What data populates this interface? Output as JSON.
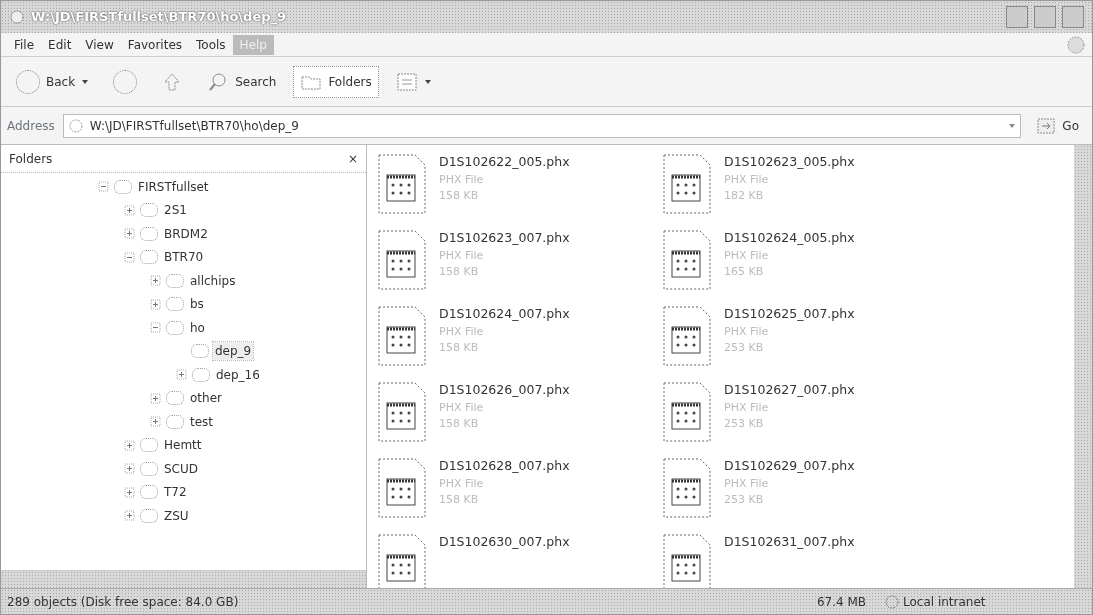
{
  "window": {
    "title": "W:\\JD\\FIRSTfullset\\BTR70\\ho\\dep_9"
  },
  "menu": [
    {
      "label": "File",
      "selected": false
    },
    {
      "label": "Edit",
      "selected": false
    },
    {
      "label": "View",
      "selected": false
    },
    {
      "label": "Favorites",
      "selected": false
    },
    {
      "label": "Tools",
      "selected": false
    },
    {
      "label": "Help",
      "selected": true
    }
  ],
  "toolbar": {
    "back": "Back",
    "search": "Search",
    "folders": {
      "label": "Folders",
      "selected": true
    }
  },
  "address": {
    "label": "Address",
    "value": "W:\\JD\\FIRSTfullset\\BTR70\\ho\\dep_9",
    "go": "Go"
  },
  "sidebar": {
    "title": "Folders",
    "close": "×",
    "items": [
      {
        "label": "FIRSTfullset",
        "expandable": true,
        "expanded": true,
        "selected": false,
        "children": [
          {
            "label": "2S1",
            "expandable": true,
            "expanded": false,
            "selected": false
          },
          {
            "label": "BRDM2",
            "expandable": true,
            "expanded": false,
            "selected": false
          },
          {
            "label": "BTR70",
            "expandable": true,
            "expanded": true,
            "selected": false,
            "children": [
              {
                "label": "allchips",
                "expandable": true,
                "expanded": false,
                "selected": false
              },
              {
                "label": "bs",
                "expandable": true,
                "expanded": false,
                "selected": false
              },
              {
                "label": "ho",
                "expandable": true,
                "expanded": true,
                "selected": false,
                "children": [
                  {
                    "label": "dep_9",
                    "expandable": false,
                    "expanded": false,
                    "selected": true
                  },
                  {
                    "label": "dep_16",
                    "expandable": true,
                    "expanded": false,
                    "selected": false
                  }
                ]
              },
              {
                "label": "other",
                "expandable": true,
                "expanded": false,
                "selected": false
              },
              {
                "label": "test",
                "expandable": true,
                "expanded": false,
                "selected": false
              }
            ]
          },
          {
            "label": "Hemtt",
            "expandable": true,
            "expanded": false,
            "selected": false
          },
          {
            "label": "SCUD",
            "expandable": true,
            "expanded": false,
            "selected": false
          },
          {
            "label": "T72",
            "expandable": true,
            "expanded": false,
            "selected": false
          },
          {
            "label": "ZSU",
            "expandable": true,
            "expanded": false,
            "selected": false
          }
        ]
      }
    ]
  },
  "files": [
    {
      "name": "D1S102622_005.phx",
      "type": "PHX File",
      "size": "158 KB"
    },
    {
      "name": "D1S102623_005.phx",
      "type": "PHX File",
      "size": "182 KB"
    },
    {
      "name": "D1S102623_007.phx",
      "type": "PHX File",
      "size": "158 KB"
    },
    {
      "name": "D1S102624_005.phx",
      "type": "PHX File",
      "size": "165 KB"
    },
    {
      "name": "D1S102624_007.phx",
      "type": "PHX File",
      "size": "158 KB"
    },
    {
      "name": "D1S102625_007.phx",
      "type": "PHX File",
      "size": "253 KB"
    },
    {
      "name": "D1S102626_007.phx",
      "type": "PHX File",
      "size": "158 KB"
    },
    {
      "name": "D1S102627_007.phx",
      "type": "PHX File",
      "size": "253 KB"
    },
    {
      "name": "D1S102628_007.phx",
      "type": "PHX File",
      "size": "158 KB"
    },
    {
      "name": "D1S102629_007.phx",
      "type": "PHX File",
      "size": "253 KB"
    },
    {
      "name": "D1S102630_007.phx"
    },
    {
      "name": "D1S102631_007.phx"
    }
  ],
  "status_bar": {
    "objects": "289 objects (Disk free space: 84.0 GB)",
    "size": "67.4 MB",
    "zone": "Local intranet"
  }
}
